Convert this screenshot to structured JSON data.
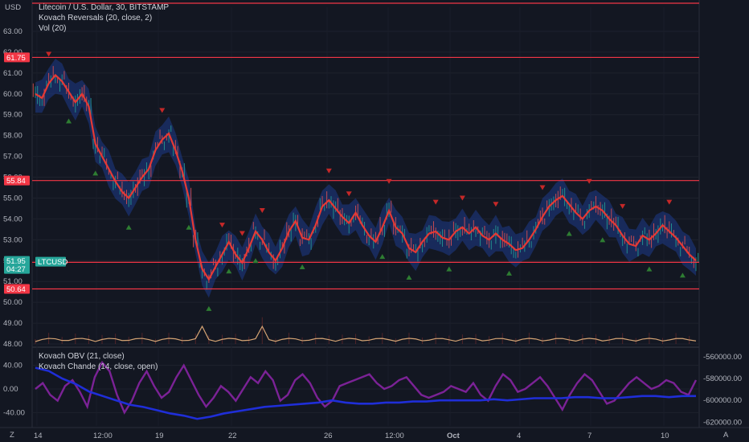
{
  "price_scale_unit": "USD",
  "legend": {
    "symbol": "Litecoin / U.S. Dollar, 30, BITSTAMP",
    "ind1": "Kovach Reversals (20, close, 2)",
    "ind2": "Vol (20)"
  },
  "lower_legend": {
    "obv": "Kovach OBV (21, close)",
    "chande": "Kovach Chande (14, close, open)"
  },
  "price_ticks": [
    "63.00",
    "62.00",
    "61.00",
    "60.00",
    "59.00",
    "58.00",
    "57.00",
    "56.00",
    "55.00",
    "54.00",
    "53.00",
    "52.00",
    "51.00",
    "50.00",
    "49.00",
    "48.00"
  ],
  "price_tick_values": [
    63,
    62,
    61,
    60,
    59,
    58,
    57,
    56,
    55,
    54,
    53,
    52,
    51,
    50,
    49,
    48
  ],
  "price_badges": [
    {
      "text": "61.75",
      "value": 61.75,
      "color": "#f23645"
    },
    {
      "text": "55.84",
      "value": 55.84,
      "color": "#f23645"
    },
    {
      "text": "51.92",
      "value": 51.92,
      "color": "#f23645"
    },
    {
      "text": "50.64",
      "value": 50.64,
      "color": "#f23645"
    }
  ],
  "current_price": {
    "value": "51.95",
    "countdown": "04:27",
    "symbol": "LTCUSD",
    "color": "#26a69a"
  },
  "hlines": [
    63.3,
    61.75,
    55.84,
    51.92,
    50.64
  ],
  "lower_left_ticks": [
    "40.00",
    "0.00",
    "-40.00"
  ],
  "lower_left_values": [
    40,
    0,
    -40
  ],
  "lower_right_ticks": [
    "-560000.00",
    "-580000.00",
    "-600000.00",
    "-620000.00"
  ],
  "lower_right_values": [
    -560000,
    -580000,
    -600000,
    -620000
  ],
  "time_labels": [
    "14",
    "12:00",
    "19",
    "22",
    "26",
    "12:00",
    "Oct",
    "4",
    "7",
    "10"
  ],
  "corner_left": "Z",
  "corner_right": "A",
  "colors": {
    "ma": "#e53935",
    "band": "#1e3a8a",
    "chande": "#8e24aa",
    "obv": "#1f2ed8",
    "vol": "#d4a373",
    "up": "#2e7d32",
    "down": "#c62828"
  },
  "chart_data": {
    "type": "line",
    "price_series_close": [
      60.0,
      59.8,
      60.5,
      60.9,
      60.6,
      60.1,
      59.6,
      60.0,
      59.4,
      57.6,
      57.0,
      56.4,
      55.8,
      55.3,
      55.0,
      55.5,
      56.0,
      56.4,
      57.3,
      57.8,
      58.1,
      57.3,
      56.3,
      55.0,
      53.0,
      51.6,
      51.1,
      51.7,
      52.3,
      52.9,
      52.3,
      51.9,
      52.6,
      53.4,
      53.0,
      52.4,
      52.0,
      52.6,
      53.4,
      53.9,
      53.1,
      53.0,
      53.7,
      54.6,
      54.9,
      54.5,
      54.1,
      53.8,
      54.3,
      53.7,
      53.2,
      52.9,
      53.6,
      54.4,
      53.6,
      53.3,
      52.6,
      52.4,
      52.9,
      53.3,
      53.4,
      53.1,
      53.0,
      53.4,
      53.6,
      53.3,
      53.6,
      53.2,
      53.0,
      53.3,
      53.0,
      52.8,
      52.5,
      52.6,
      53.0,
      53.5,
      54.1,
      54.6,
      54.9,
      55.1,
      54.7,
      54.3,
      54.0,
      54.4,
      54.6,
      54.4,
      54.0,
      53.7,
      53.2,
      52.8,
      52.7,
      53.2,
      53.0,
      53.3,
      53.7,
      53.4,
      53.1,
      52.7,
      52.3,
      52.0
    ],
    "chande_series": [
      0,
      10,
      -10,
      -20,
      5,
      15,
      -5,
      -30,
      20,
      45,
      30,
      -10,
      -40,
      -20,
      10,
      30,
      5,
      -15,
      -5,
      20,
      40,
      15,
      -10,
      -30,
      -15,
      5,
      -5,
      -20,
      0,
      20,
      10,
      30,
      15,
      -20,
      -10,
      15,
      25,
      10,
      -15,
      -30,
      -20,
      5,
      10,
      15,
      20,
      25,
      10,
      0,
      5,
      15,
      20,
      5,
      -10,
      -15,
      -10,
      -5,
      5,
      0,
      -5,
      10,
      -10,
      -20,
      5,
      25,
      15,
      -5,
      0,
      10,
      20,
      5,
      -15,
      -35,
      -10,
      10,
      25,
      15,
      -5,
      -25,
      -20,
      -5,
      10,
      20,
      10,
      0,
      5,
      15,
      10,
      -5,
      -10,
      15
    ],
    "obv_series": [
      -570000,
      -573000,
      -580000,
      -585000,
      -592000,
      -596000,
      -600000,
      -604000,
      -606000,
      -609000,
      -612000,
      -614000,
      -617000,
      -615000,
      -612000,
      -610000,
      -608000,
      -606000,
      -605000,
      -604000,
      -603000,
      -602000,
      -600000,
      -602000,
      -603000,
      -603000,
      -602000,
      -602000,
      -601000,
      -601000,
      -600000,
      -600000,
      -600000,
      -600000,
      -599000,
      -600000,
      -599000,
      -598000,
      -598000,
      -598000,
      -597000,
      -597000,
      -598000,
      -598000,
      -597000,
      -596000,
      -596000,
      -597000,
      -596000,
      -596000
    ],
    "ylim_price": [
      48,
      63.5
    ],
    "ylim_osc": [
      -60,
      60
    ],
    "ylim_obv": [
      -622000,
      -557000
    ]
  }
}
